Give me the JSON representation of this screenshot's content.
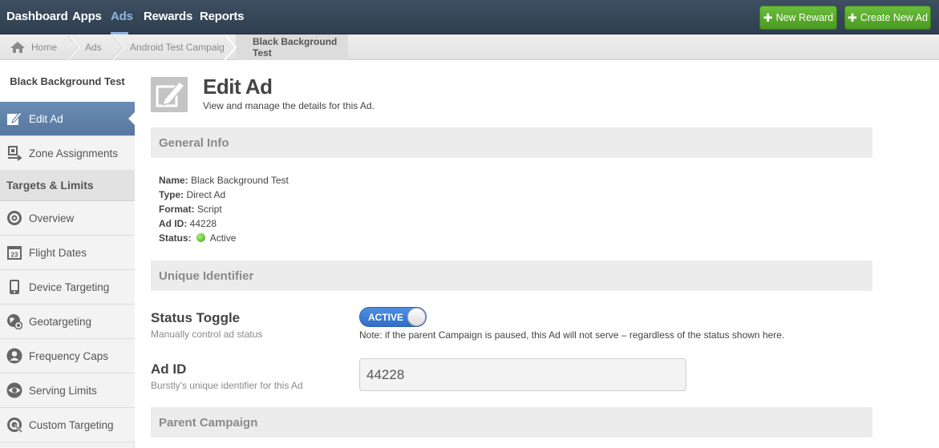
{
  "topnav": {
    "items": [
      "Dashboard",
      "Apps",
      "Ads",
      "Rewards",
      "Reports"
    ],
    "active": "Ads",
    "buttons": {
      "new_reward": "New Reward",
      "create_new_ad": "Create New Ad"
    }
  },
  "breadcrumb": [
    "Home",
    "Ads",
    "Android Test Campaign",
    "Black Background Test"
  ],
  "sidebar": {
    "title": "Black Background Test",
    "items": [
      {
        "label": "Edit Ad",
        "icon": "edit-icon"
      },
      {
        "label": "Zone Assignments",
        "icon": "zone-icon"
      }
    ],
    "section_title": "Targets & Limits",
    "section_items": [
      {
        "label": "Overview",
        "icon": "target-icon"
      },
      {
        "label": "Flight Dates",
        "icon": "calendar-icon"
      },
      {
        "label": "Device Targeting",
        "icon": "device-icon"
      },
      {
        "label": "Geotargeting",
        "icon": "globe-icon"
      },
      {
        "label": "Frequency Caps",
        "icon": "user-icon"
      },
      {
        "label": "Serving Limits",
        "icon": "eye-icon"
      },
      {
        "label": "Custom Targeting",
        "icon": "custom-target-icon"
      }
    ],
    "calendar_day": "23"
  },
  "main": {
    "title": "Edit Ad",
    "subtitle": "View and manage the details for this Ad.",
    "general_info": {
      "heading": "General Info",
      "name_label": "Name:",
      "name_value": "Black Background Test",
      "type_label": "Type:",
      "type_value": "Direct Ad",
      "format_label": "Format:",
      "format_value": "Script",
      "adid_label": "Ad ID:",
      "adid_value": "44228",
      "status_label": "Status:",
      "status_value": "Active"
    },
    "unique_identifier": {
      "heading": "Unique Identifier",
      "status_toggle_label": "Status Toggle",
      "status_toggle_help": "Manually control ad status",
      "toggle_text": "ACTIVE",
      "note": "Note: if the parent Campaign is paused, this Ad will not serve – regardless of the status shown here.",
      "adid_label": "Ad ID",
      "adid_help": "Burstly's unique identifier for this Ad",
      "adid_value": "44228"
    },
    "parent_campaign_heading": "Parent Campaign"
  },
  "colors": {
    "accent": "#8fb6e0",
    "green_button": "#5aab2e",
    "sidebar_active": "#6384ab",
    "toggle": "#3d7fd6"
  }
}
